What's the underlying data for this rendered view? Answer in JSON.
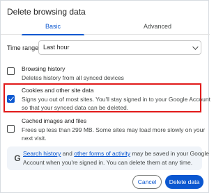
{
  "dialog": {
    "title": "Delete browsing data"
  },
  "tabs": [
    {
      "label": "Basic",
      "active": true
    },
    {
      "label": "Advanced",
      "active": false
    }
  ],
  "time_range": {
    "label": "Time range",
    "value": "Last hour"
  },
  "options": [
    {
      "title": "Browsing history",
      "description": [
        "Deletes history from all synced devices"
      ],
      "checked": false
    },
    {
      "title": "Cookies and other site data",
      "description": [
        "Signs you out of most sites. You'll stay signed in to your Google Account",
        "so that your synced data can be deleted."
      ],
      "checked": true
    },
    {
      "title": "Cached images and files",
      "description": [
        "Frees up less than 299 MB. Some sites may load more slowly on your",
        "next visit."
      ],
      "checked": false
    }
  ],
  "info": {
    "icon": "G",
    "link1": "Search history",
    "text1": " and ",
    "link2": "other forms of activity",
    "text2": " may be saved in your Google",
    "line2": "Account when you're signed in. You can delete them at any time."
  },
  "buttons": {
    "cancel": "Cancel",
    "delete": "Delete data"
  },
  "colors": {
    "accent": "#0b57d0",
    "highlight_border": "#e11919",
    "info_bg": "#f0f4f9"
  }
}
